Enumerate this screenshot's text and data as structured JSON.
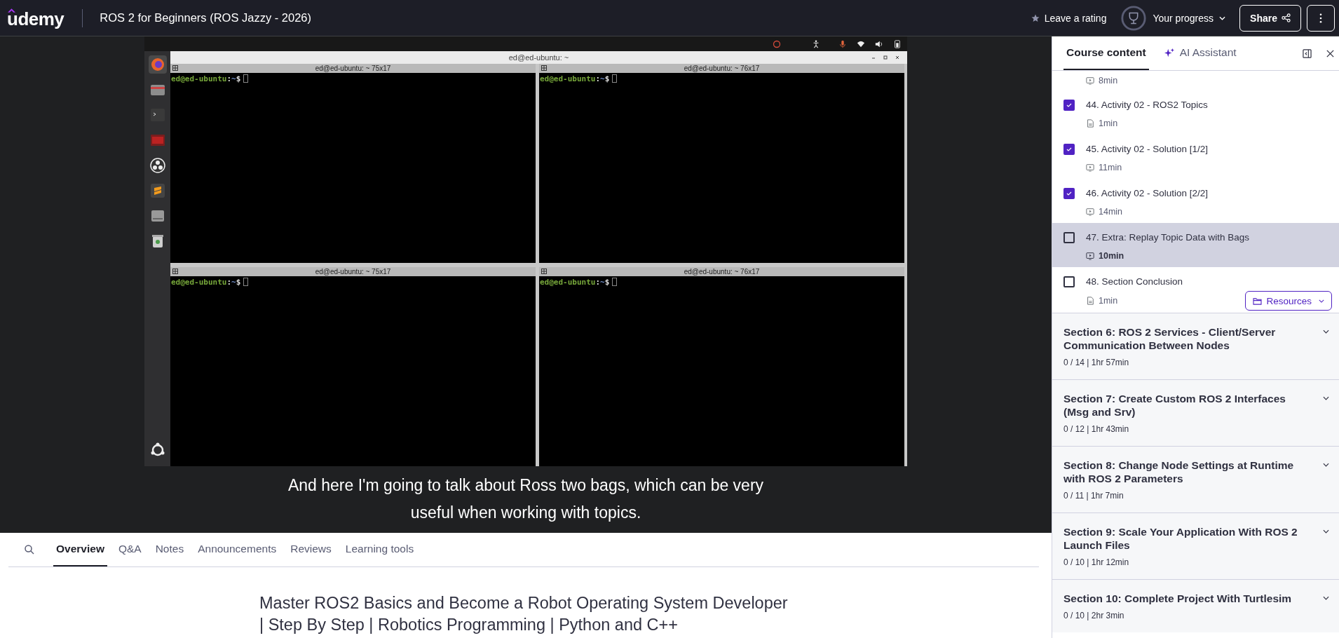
{
  "header": {
    "logo": "udemy",
    "course_title": "ROS 2 for Beginners (ROS Jazzy - 2026)",
    "rating_link": "Leave a rating",
    "progress_label": "Your progress",
    "share_button": "Share"
  },
  "video": {
    "terminal_window": {
      "title": "ed@ed-ubuntu: ~",
      "panes": [
        {
          "title": "ed@ed-ubuntu: ~ 75x17",
          "user": "ed@ed-ubuntu",
          "separator": ":",
          "path": "~",
          "symbol": "$"
        },
        {
          "title": "ed@ed-ubuntu: ~ 76x17",
          "user": "ed@ed-ubuntu",
          "separator": ":",
          "path": "~",
          "symbol": "$"
        },
        {
          "title": "ed@ed-ubuntu: ~ 75x17",
          "user": "ed@ed-ubuntu",
          "separator": ":",
          "path": "~",
          "symbol": "$"
        },
        {
          "title": "ed@ed-ubuntu: ~ 76x17",
          "user": "ed@ed-ubuntu",
          "separator": ":",
          "path": "~",
          "symbol": "$"
        }
      ]
    },
    "caption_lines": [
      "And here I'm going to talk about Ross two bags, which can be very",
      "useful when working with topics."
    ]
  },
  "tabs": [
    {
      "label": "Overview",
      "selected": true
    },
    {
      "label": "Q&A",
      "selected": false
    },
    {
      "label": "Notes",
      "selected": false
    },
    {
      "label": "Announcements",
      "selected": false
    },
    {
      "label": "Reviews",
      "selected": false
    },
    {
      "label": "Learning tools",
      "selected": false
    }
  ],
  "overview_title": "Master ROS2 Basics and Become a Robot Operating System Developer | Step By Step | Robotics Programming | Python and C++",
  "sidebar": {
    "tabs": [
      {
        "label": "Course content",
        "selected": true
      },
      {
        "label": "AI Assistant",
        "selected": false
      }
    ],
    "partial_lecture": {
      "duration": "8min",
      "kind": "video"
    },
    "lectures": [
      {
        "title": "44. Activity 02 - ROS2 Topics",
        "duration": "1min",
        "kind": "article",
        "checked": true,
        "selected": false
      },
      {
        "title": "45. Activity 02 - Solution [1/2]",
        "duration": "11min",
        "kind": "video",
        "checked": true,
        "selected": false
      },
      {
        "title": "46. Activity 02 - Solution [2/2]",
        "duration": "14min",
        "kind": "video",
        "checked": true,
        "selected": false
      },
      {
        "title": "47. Extra: Replay Topic Data with Bags",
        "duration": "10min",
        "kind": "video",
        "checked": false,
        "selected": true
      },
      {
        "title": "48. Section Conclusion",
        "duration": "1min",
        "kind": "article",
        "checked": false,
        "selected": false,
        "resources": "Resources"
      }
    ],
    "sections": [
      {
        "title": "Section 6: ROS 2 Services - Client/Server Communication Between Nodes",
        "summary": "0 / 14 | 1hr 57min",
        "expanded": false
      },
      {
        "title": "Section 7: Create Custom ROS 2 Interfaces (Msg and Srv)",
        "summary": "0 / 12 | 1hr 43min",
        "expanded": false
      },
      {
        "title": "Section 8: Change Node Settings at Runtime with ROS 2 Parameters",
        "summary": "0 / 11 | 1hr 7min",
        "expanded": false
      },
      {
        "title": "Section 9: Scale Your Application With ROS 2 Launch Files",
        "summary": "0 / 10 | 1hr 12min",
        "expanded": false
      },
      {
        "title": "Section 10: Complete Project With Turtlesim",
        "summary": "0 / 10 | 2hr 3min",
        "expanded": false
      }
    ]
  }
}
